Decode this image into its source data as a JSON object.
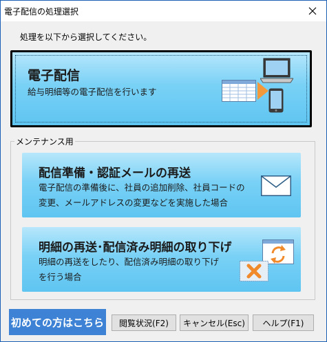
{
  "window": {
    "title": "電子配信の処理選択"
  },
  "prompt": "処理を以下から選択してください。",
  "cards": {
    "distribution": {
      "title": "電子配信",
      "desc": "給与明細等の電子配信を行います"
    },
    "prep": {
      "title": "配信準備・認証メールの再送",
      "desc_line1": "電子配信の準備後に、社員の追加削除、社員コードの",
      "desc_line2": "変更、メールアドレスの変更などを実施した場合"
    },
    "resend": {
      "title": "明細の再送･配信済み明細の取り下げ",
      "desc_line1": "明細の再送をしたり、配信済み明細の取り下げ",
      "desc_line2": "を行う場合"
    }
  },
  "group": {
    "label": "メンテナンス用"
  },
  "buttons": {
    "first_time": "初めての方はこちら",
    "view_status": "閲覧状況(F2)",
    "cancel": "キャンセル(Esc)",
    "help": "ヘルプ(F1)"
  },
  "icons": [
    "close-icon",
    "laptop-icon",
    "smartphone-icon",
    "spreadsheet-icon",
    "arrow-right-icon",
    "envelope-icon",
    "refresh-icon",
    "delete-x-icon"
  ],
  "colors": {
    "card_top": "#b7e7fb",
    "card_bottom": "#5fc5f1",
    "first_button": "#3d82d4",
    "window_border": "#1a5fb4"
  }
}
